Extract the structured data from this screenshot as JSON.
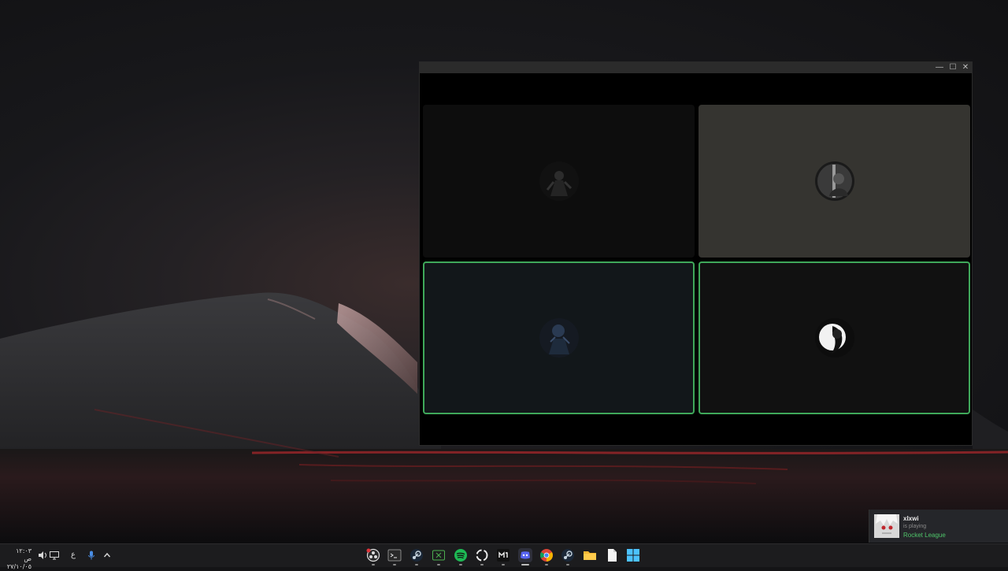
{
  "window": {
    "controls": {
      "minimize": "—",
      "maximize": "☐",
      "close": "✕"
    },
    "participants": [
      {
        "avatar": "dark-armored-figure-avatar",
        "speaking": false
      },
      {
        "avatar": "monochrome-figure-avatar",
        "speaking": false
      },
      {
        "avatar": "blue-armored-figure-avatar",
        "speaking": true
      },
      {
        "avatar": "white-silhouette-avatar",
        "speaking": true
      }
    ]
  },
  "toast": {
    "name": "xlxwi",
    "status": "is playing",
    "game": "Rocket League",
    "game_color": "#4fc46a"
  },
  "taskbar": {
    "clock_time": "١٢:٠٣ ص",
    "clock_date": "٢٧/١٠/٠٥",
    "language": "ع",
    "tray_icons": [
      "volume-icon",
      "display-icon",
      "language-indicator",
      "microphone-icon",
      "chevron-up-icon"
    ],
    "apps": [
      "obs-icon",
      "terminal-icon",
      "steam-icon",
      "xbox-icon",
      "spotify-icon",
      "circle-app-icon",
      "epic-icon",
      "discord-icon",
      "chrome-icon",
      "steam-icon",
      "folder-icon",
      "document-icon",
      "windows-icon"
    ]
  },
  "accent_colors": {
    "speaking_border": "#3fa85a",
    "discord": "#5865f2",
    "spotify": "#1db954"
  }
}
